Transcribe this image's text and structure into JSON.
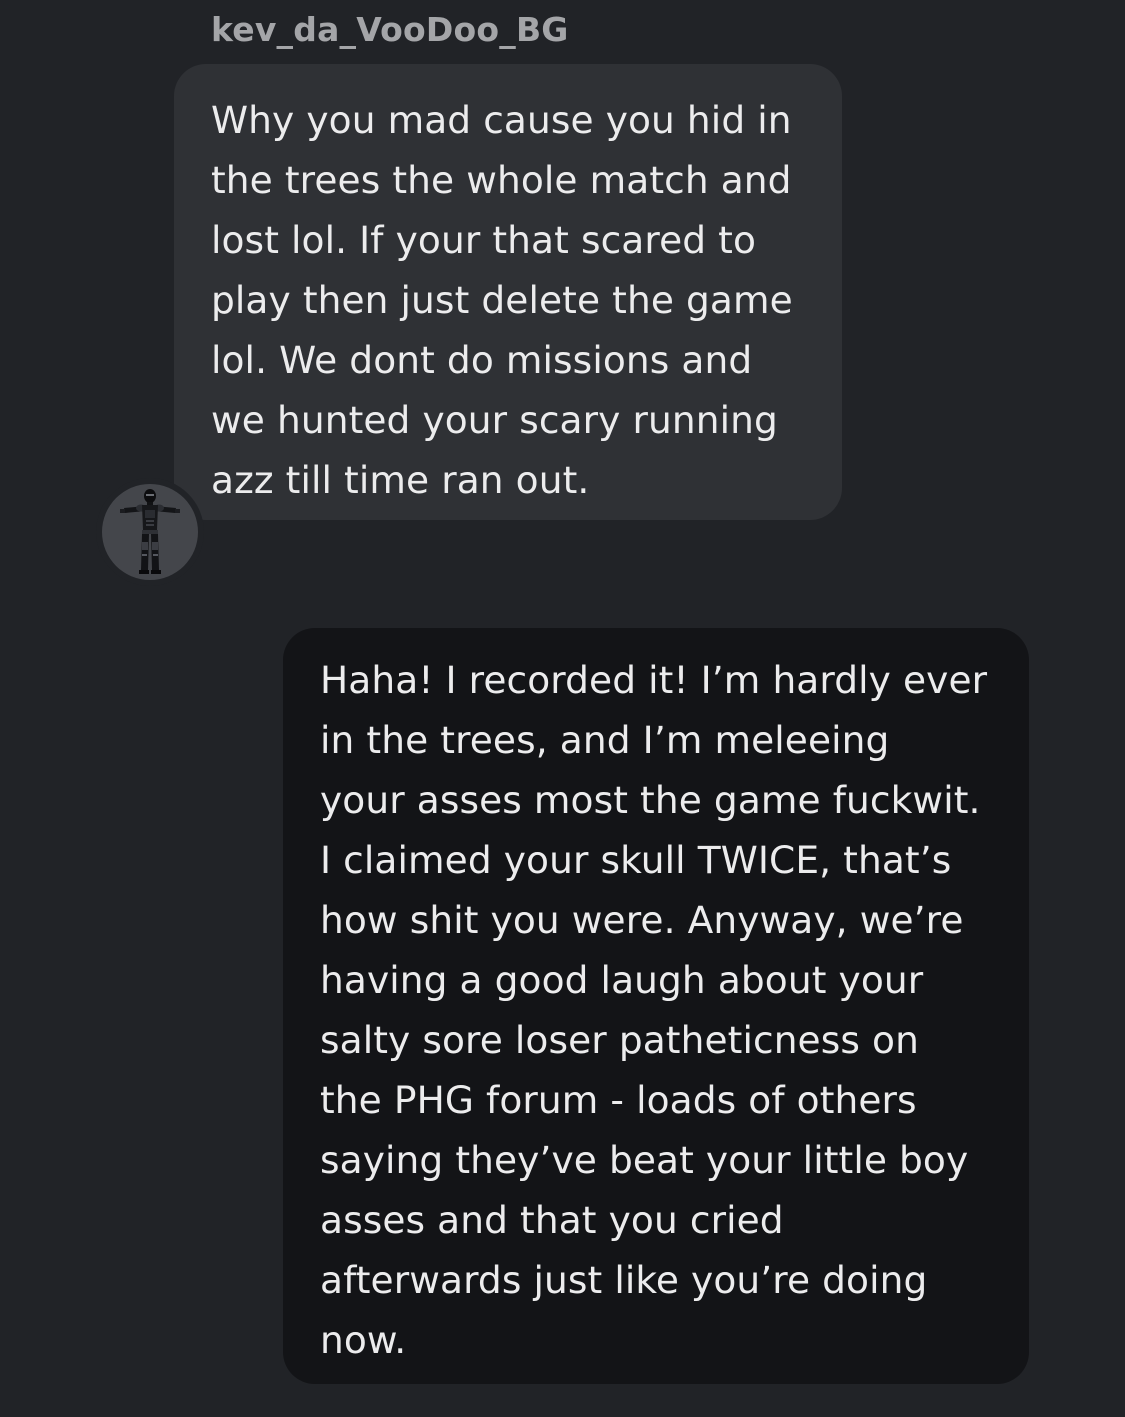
{
  "conversation": {
    "sender_name": "kev_da_VooDoo_BG",
    "avatar_icon": "armored-soldier-avatar-icon",
    "messages": [
      {
        "direction": "incoming",
        "text": "Why you mad cause you hid in\nthe trees the whole match and\nlost lol. If your that scared to\nplay then just delete the game\nlol. We dont do missions and\nwe hunted your scary running\nazz till time ran out."
      },
      {
        "direction": "outgoing",
        "text": "Haha! I recorded it! I’m hardly ever\nin the trees, and I’m meleeing\nyour asses most the game fuckwit.\nI claimed your skull TWICE, that’s\nhow shit you were. Anyway, we’re\nhaving a good laugh about your\nsalty sore loser patheticness on\nthe PHG forum - loads of others\nsaying they’ve beat your little boy\nasses and that you cried\nafterwards just like you’re doing\nnow."
      }
    ]
  },
  "colors": {
    "background": "#212327",
    "incoming_bubble": "#2f3135",
    "outgoing_bubble": "#131417",
    "sender_name": "#a4a5a8",
    "message_text": "#ececed"
  }
}
